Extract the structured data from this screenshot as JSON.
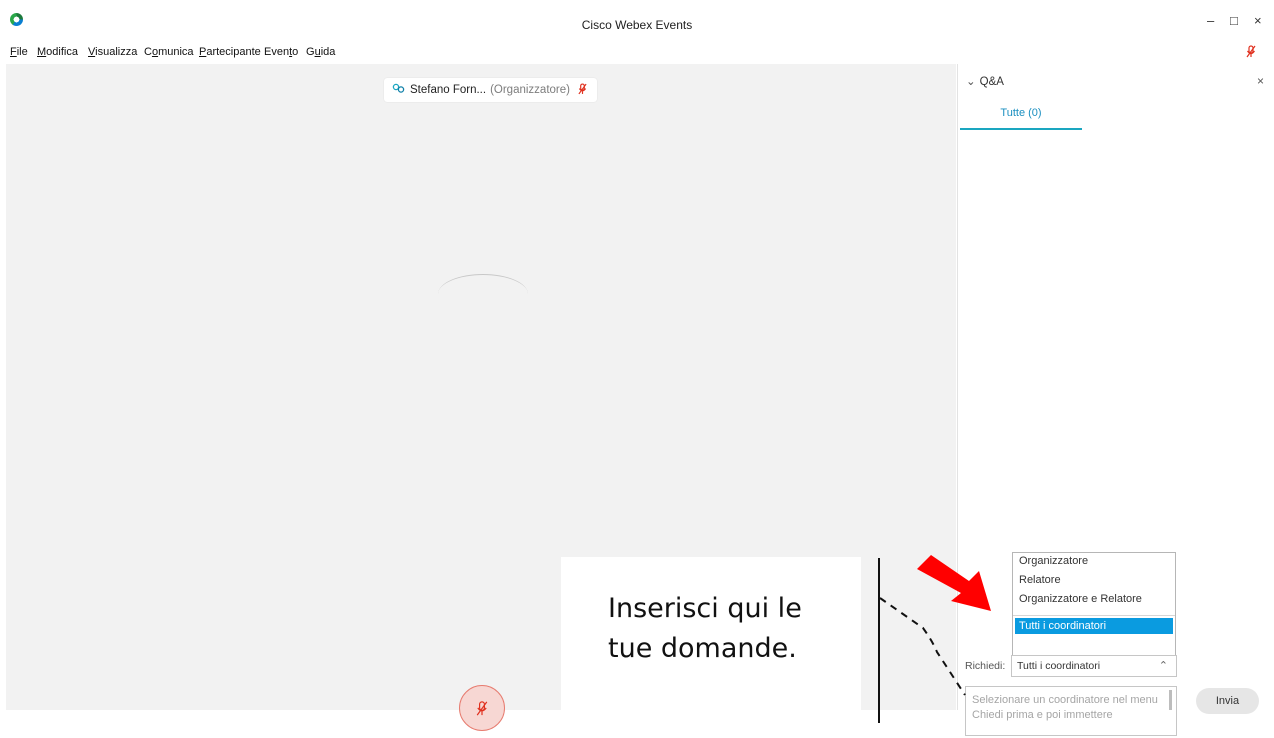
{
  "window": {
    "title": "Cisco Webex Events",
    "controls": {
      "minimize": "–",
      "maximize": "□",
      "close": "×"
    }
  },
  "menu": {
    "items": [
      {
        "before": "",
        "accel": "F",
        "after": "ile"
      },
      {
        "before": "",
        "accel": "M",
        "after": "odifica"
      },
      {
        "before": "",
        "accel": "V",
        "after": "isualizza"
      },
      {
        "before": "C",
        "accel": "o",
        "after": "munica"
      },
      {
        "before": "",
        "accel": "P",
        "after": "artecipante"
      },
      {
        "before": "Even",
        "accel": "t",
        "after": "o"
      },
      {
        "before": "G",
        "accel": "u",
        "after": "ida"
      }
    ],
    "mic_icon": "microphone-muted-icon"
  },
  "stage": {
    "speaker_name": "Stefano Forn...",
    "speaker_role": "(Organizzatore)",
    "speaker_icon": "presenter-icon",
    "mic_icon": "microphone-muted-icon"
  },
  "qa": {
    "header": "Q&A",
    "close": "×",
    "tab_all": "Tutte (0)",
    "dropdown_options": [
      "Organizzatore",
      "Relatore",
      "Organizzatore e Relatore",
      "Tutti i coordinatori"
    ],
    "ask_label": "Richiedi:",
    "ask_value": "Tutti i coordinatori",
    "question_placeholder": "Selezionare un coordinatore nel menu Chiedi prima e poi immettere",
    "send_label": "Invia"
  },
  "annotation": {
    "text": "Inserisci qui le tue domande."
  },
  "colors": {
    "accent": "#1aa6c0",
    "selection": "#0a9be0",
    "muted_red": "#e0301e",
    "arrow_red": "#ff0000"
  }
}
